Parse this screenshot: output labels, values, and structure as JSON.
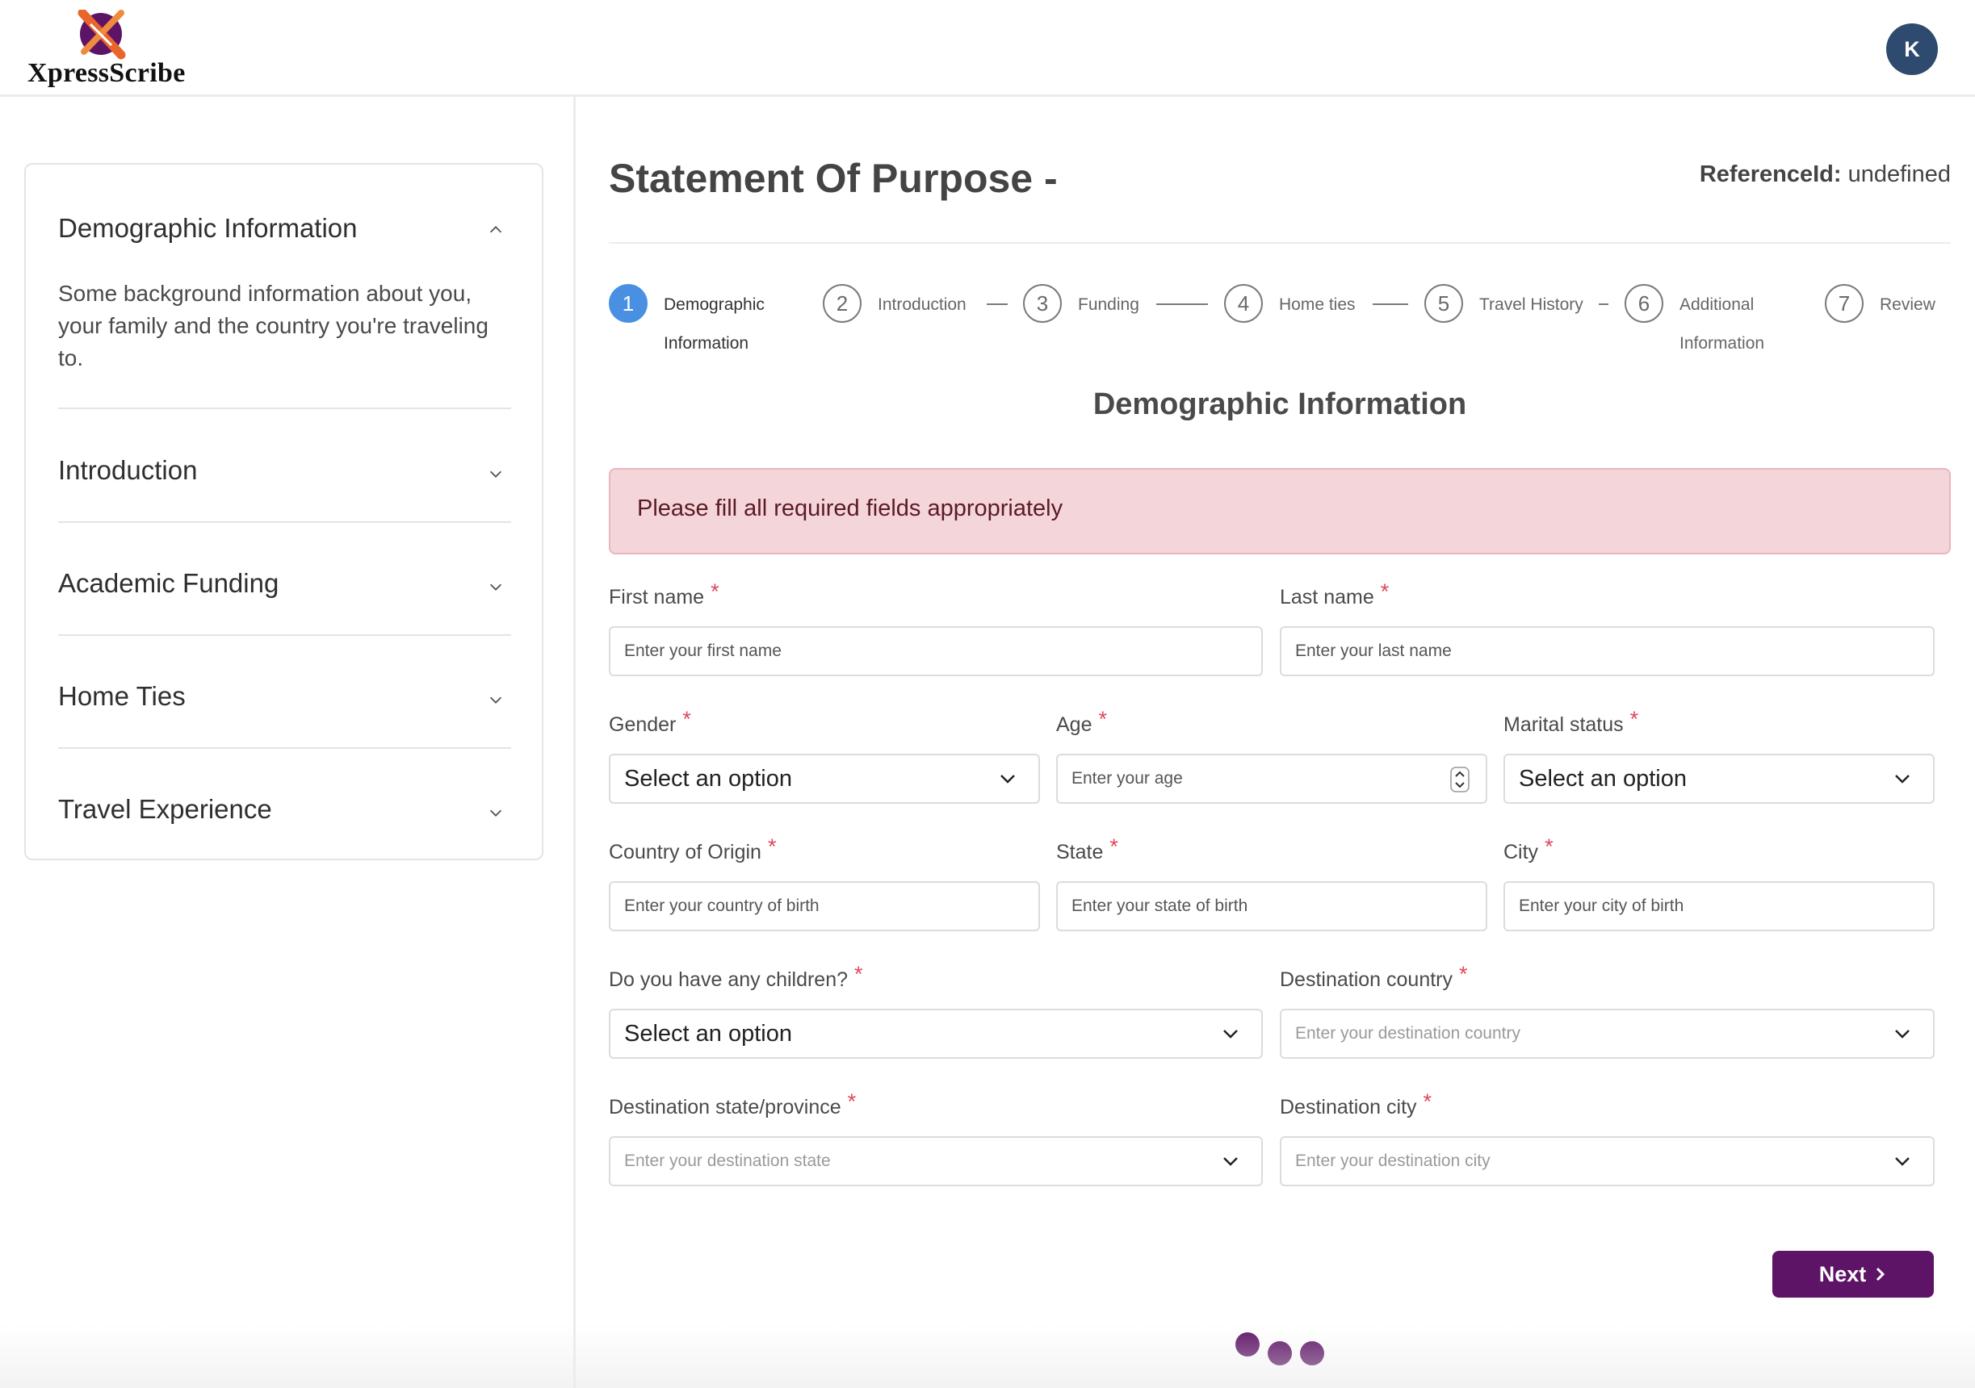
{
  "app": {
    "brand": "XpressScribe",
    "avatar_initial": "K",
    "colors": {
      "primary": "#5e1466",
      "step_active": "#4a90e2",
      "alert_bg": "#f4d6da",
      "required": "#e0485a",
      "avatar": "#2e4a6e"
    }
  },
  "sidebar": {
    "sections": [
      {
        "title": "Demographic Information",
        "expanded": true,
        "description": "Some background information about you, your family and the country you're traveling to.",
        "icon": "chevron-up-icon"
      },
      {
        "title": "Introduction",
        "expanded": false,
        "icon": "chevron-down-icon"
      },
      {
        "title": "Academic Funding",
        "expanded": false,
        "icon": "chevron-down-icon"
      },
      {
        "title": "Home Ties",
        "expanded": false,
        "icon": "chevron-down-icon"
      },
      {
        "title": "Travel Experience",
        "expanded": false,
        "icon": "chevron-down-icon"
      }
    ]
  },
  "main": {
    "title": "Statement Of Purpose -",
    "reference_label": "ReferenceId:",
    "reference_value": "undefined",
    "steps": [
      {
        "number": "1",
        "label_line1": "Demographic",
        "label_line2": "Information",
        "active": true
      },
      {
        "number": "2",
        "label_line1": "Introduction"
      },
      {
        "number": "3",
        "label_line1": "Funding"
      },
      {
        "number": "4",
        "label_line1": "Home ties"
      },
      {
        "number": "5",
        "label_line1": "Travel History"
      },
      {
        "number": "6",
        "label_line1": "Additional",
        "label_line2": "Information"
      },
      {
        "number": "7",
        "label_line1": "Review"
      }
    ],
    "section_heading": "Demographic Information",
    "alert": "Please fill all required fields appropriately",
    "required_mark": "*",
    "form": {
      "first_name": {
        "label": "First name",
        "placeholder": "Enter your first name"
      },
      "last_name": {
        "label": "Last name",
        "placeholder": "Enter your last name"
      },
      "gender": {
        "label": "Gender",
        "value": "Select an option"
      },
      "age": {
        "label": "Age",
        "placeholder": "Enter your age"
      },
      "marital_status": {
        "label": "Marital status",
        "value": "Select an option"
      },
      "country_of_origin": {
        "label": "Country of Origin",
        "placeholder": "Enter your country of birth"
      },
      "state": {
        "label": "State",
        "placeholder": "Enter your state of birth"
      },
      "city": {
        "label": "City",
        "placeholder": "Enter your city of birth"
      },
      "children": {
        "label": "Do you have any children?",
        "value": "Select an option"
      },
      "destination_country": {
        "label": "Destination country",
        "placeholder": "Enter your destination country"
      },
      "destination_state": {
        "label": "Destination state/province",
        "placeholder": "Enter your destination state"
      },
      "destination_city": {
        "label": "Destination city",
        "placeholder": "Enter your destination city"
      }
    },
    "next_label": "Next"
  }
}
